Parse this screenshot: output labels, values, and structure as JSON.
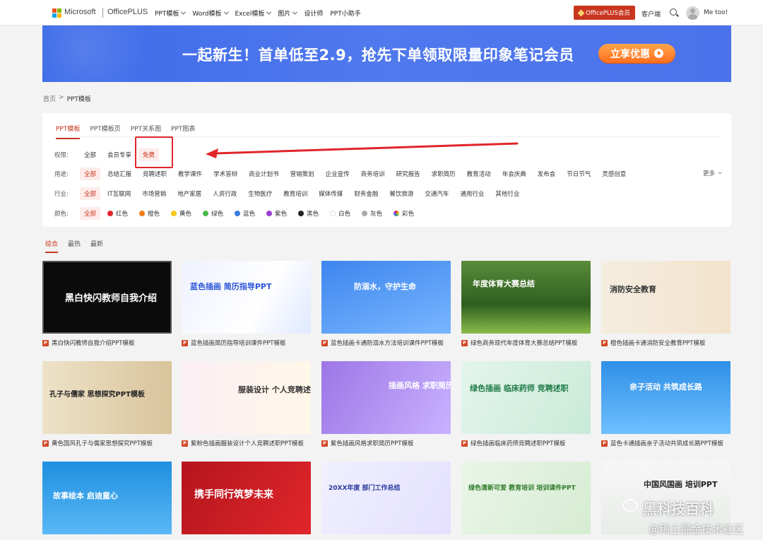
{
  "header": {
    "brand": "Microsoft",
    "product": "OfficePLUS",
    "nav": [
      {
        "label": "PPT模板",
        "dropdown": true
      },
      {
        "label": "Word模板",
        "dropdown": true
      },
      {
        "label": "Excel模板",
        "dropdown": true
      },
      {
        "label": "图片",
        "dropdown": true
      },
      {
        "label": "设计师",
        "dropdown": false
      },
      {
        "label": "PPT小助手",
        "dropdown": false
      }
    ],
    "vip_button": "OfficePLUS会员",
    "client": "客户端",
    "username": "Me too!"
  },
  "banner": {
    "text": "一起新生！首单低至2.9，抢先下单领取限量印象笔记会员",
    "button": "立享优惠"
  },
  "breadcrumb": {
    "home": "首页",
    "sep": ">",
    "current": "PPT模板"
  },
  "panel": {
    "tabs": [
      "PPT模板",
      "PPT模板页",
      "PPT关系图",
      "PPT图表"
    ],
    "permission": {
      "label": "权限:",
      "options": [
        "全部",
        "会员专享",
        "免费"
      ]
    },
    "usage": {
      "label": "用途:",
      "options": [
        "全部",
        "总结汇报",
        "竞聘述职",
        "教学课件",
        "学术答辩",
        "商业计划书",
        "营销策划",
        "企业宣传",
        "商务培训",
        "研究报告",
        "求职简历",
        "教育活动",
        "年会庆典",
        "发布会",
        "节日节气",
        "灵感创意"
      ],
      "more": "更多"
    },
    "industry": {
      "label": "行业:",
      "options": [
        "全部",
        "IT互联网",
        "市场营销",
        "地产家居",
        "人资行政",
        "生物医疗",
        "教育培训",
        "媒体传媒",
        "财务金融",
        "餐饮旅游",
        "交通汽车",
        "通用行业",
        "其他行业"
      ]
    },
    "color": {
      "label": "颜色:",
      "all": "全部",
      "options": [
        {
          "name": "红色",
          "hex": "#e0262b"
        },
        {
          "name": "橙色",
          "hex": "#f07d1a"
        },
        {
          "name": "黄色",
          "hex": "#f5c518"
        },
        {
          "name": "绿色",
          "hex": "#4cb84a"
        },
        {
          "name": "蓝色",
          "hex": "#3a7be0"
        },
        {
          "name": "紫色",
          "hex": "#9b3fd6"
        },
        {
          "name": "黑色",
          "hex": "#222222"
        },
        {
          "name": "白色",
          "hex": "#ffffff"
        },
        {
          "name": "灰色",
          "hex": "#aaaaaa"
        },
        {
          "name": "彩色",
          "hex": "rainbow"
        }
      ]
    }
  },
  "sort": [
    "综合",
    "最热",
    "最新"
  ],
  "cards": [
    {
      "title": "黑白快闪教师自我介绍PPT模板",
      "thumb_text": "黑白快闪教师自我介绍"
    },
    {
      "title": "蓝色插画简历指导培训课件PPT模板",
      "thumb_text": "蓝色插画 简历指导PPT"
    },
    {
      "title": "蓝色插画卡通防溺水方法培训课件PPT模板",
      "thumb_text": "防溺水，守护生命"
    },
    {
      "title": "绿色商务现代年度体育大赛总结PPT模板",
      "thumb_text": "年度体育大赛总结"
    },
    {
      "title": "橙色插画卡通消防安全教育PPT模板",
      "thumb_text": "消防安全教育"
    },
    {
      "title": "黄色国风孔子与儒家思想探究PPT模板",
      "thumb_text": "孔子与儒家 思想探究PPT模板"
    },
    {
      "title": "紫粉色插画服装设计个人竞聘述职PPT模板",
      "thumb_text": "服装设计 个人竞聘述职PPT"
    },
    {
      "title": "紫色插画风格求职简历PPT模板",
      "thumb_text": "插画风格 求职简历PPT"
    },
    {
      "title": "绿色插画临床药师竞聘述职PPT模板",
      "thumb_text": "绿色插画 临床药师 竞聘述职"
    },
    {
      "title": "蓝色卡通插画亲子活动共筑成长路PPT模板",
      "thumb_text": "亲子活动 共筑成长路"
    },
    {
      "title": "",
      "thumb_text": "故事绘本 启迪童心"
    },
    {
      "title": "",
      "thumb_text": "携手同行筑梦未来"
    },
    {
      "title": "",
      "thumb_text": "20XX年度 部门工作总结"
    },
    {
      "title": "",
      "thumb_text": "绿色清新可爱 教育培训 培训课件PPT"
    },
    {
      "title": "",
      "thumb_text": "中国风国画 培训PPT"
    }
  ],
  "watermark": {
    "line1": "黑科技百科",
    "line2": "@稀土掘金技术社区"
  }
}
